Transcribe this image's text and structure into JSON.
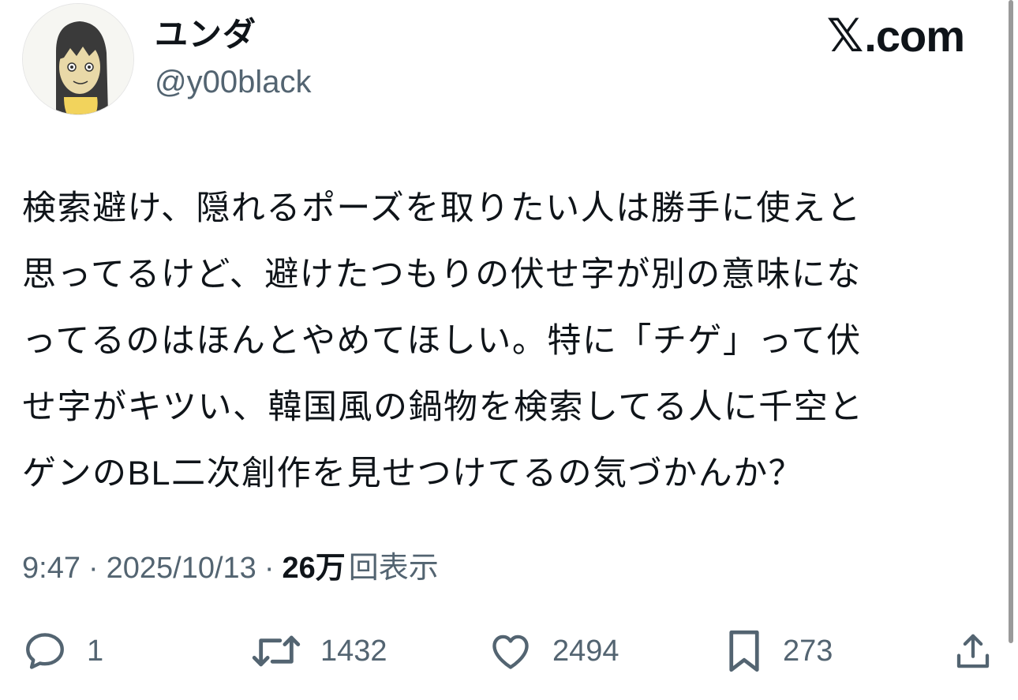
{
  "author": {
    "display_name": "ユンダ",
    "handle": "@y00black"
  },
  "brand": {
    "label": ".com",
    "icon": "x-logo-icon"
  },
  "tweet": {
    "text": "検索避け、隠れるポーズを取りたい人は勝手に使えと\n思ってるけど、避けたつもりの伏せ字が別の意味にな\nってるのはほんとやめてほしい。特に「チゲ」って伏\nせ字がキツい、韓国風の鍋物を検索してる人に千空と\nゲンのBL二次創作を見せつけてるの気づかんか？"
  },
  "meta": {
    "time": "9:47",
    "date": "2025/10/13",
    "separator": "·",
    "views_count": "26万",
    "views_label": "回表示"
  },
  "actions": {
    "replies": "1",
    "reposts": "1432",
    "likes": "2494",
    "bookmarks": "273"
  },
  "colors": {
    "text": "#0f1419",
    "secondary": "#536471",
    "background": "#ffffff"
  }
}
